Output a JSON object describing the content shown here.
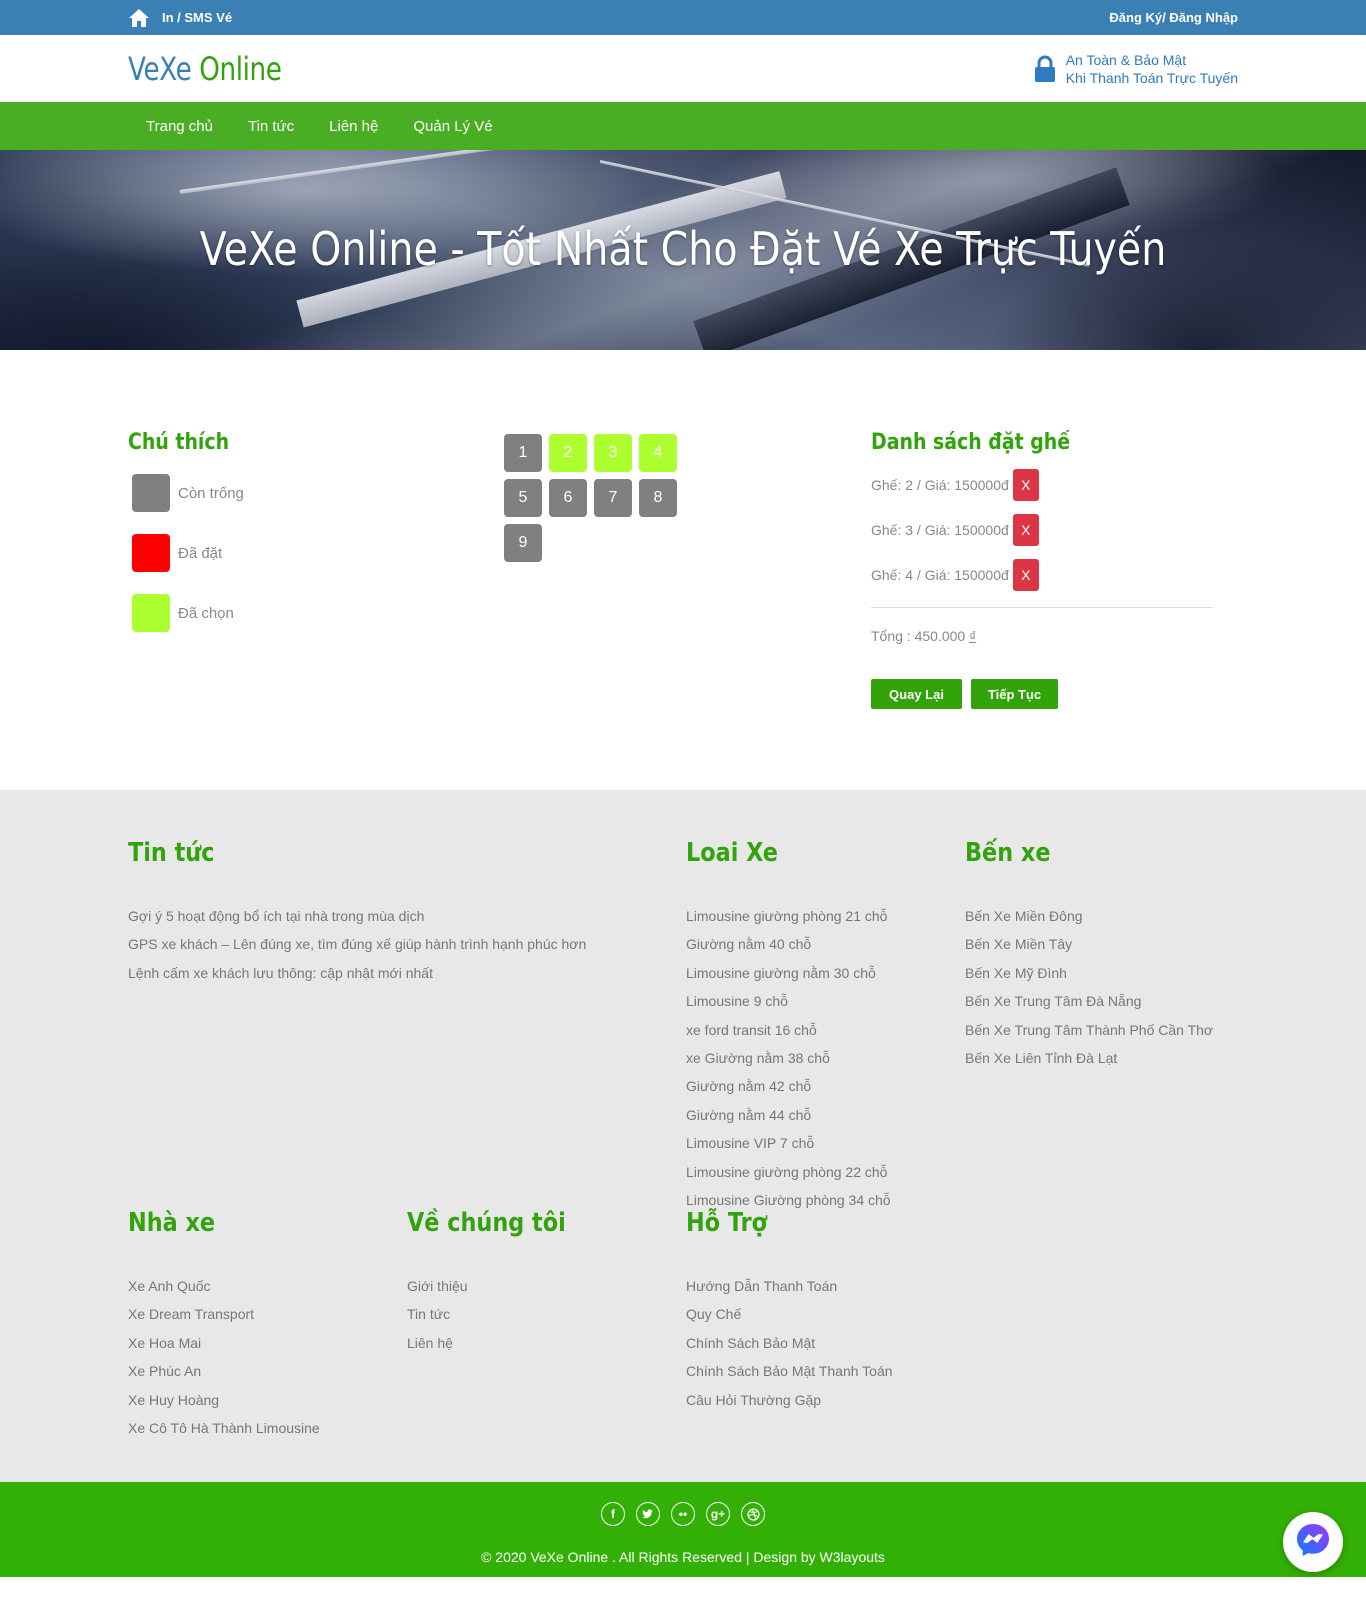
{
  "topbar": {
    "print_label": "In / SMS Vé",
    "auth_label": "Đăng Ký/ Đăng Nhập"
  },
  "brand": {
    "logo_part1": "VeXe",
    "logo_part2": "Online",
    "secure_line1": "An Toàn & Bảo Mật",
    "secure_line2": "Khi Thanh Toán Trực Tuyến"
  },
  "nav": [
    "Trang chủ",
    "Tin tức",
    "Liên hệ",
    "Quản Lý Vé"
  ],
  "hero": {
    "title": "VeXe Online - Tốt Nhất Cho Đặt Vé Xe Trực Tuyến"
  },
  "legend": {
    "title": "Chú thích",
    "items": [
      {
        "label": "Còn trống",
        "color": "#808080"
      },
      {
        "label": "Đã đặt",
        "color": "#ff0000"
      },
      {
        "label": "Đã chọn",
        "color": "#adff2f"
      }
    ]
  },
  "seats": [
    {
      "number": "1",
      "status": "free"
    },
    {
      "number": "2",
      "status": "selected"
    },
    {
      "number": "3",
      "status": "selected"
    },
    {
      "number": "4",
      "status": "selected"
    },
    {
      "number": "5",
      "status": "free"
    },
    {
      "number": "6",
      "status": "free"
    },
    {
      "number": "7",
      "status": "free"
    },
    {
      "number": "8",
      "status": "free"
    },
    {
      "number": "9",
      "status": "free"
    }
  ],
  "booking": {
    "title": "Danh sách đặt ghế",
    "items": [
      {
        "text": "Ghế: 2 / Giá: 150000đ",
        "remove": "X"
      },
      {
        "text": "Ghế: 3 / Giá: 150000đ",
        "remove": "X"
      },
      {
        "text": "Ghế: 4 / Giá: 150000đ",
        "remove": "X"
      }
    ],
    "total_label": "Tổng : 450.000",
    "currency": "₫",
    "back_label": "Quay Lại",
    "next_label": "Tiếp Tục"
  },
  "footer": {
    "news": {
      "title": "Tin tức",
      "items": [
        "Gợi ý 5 hoạt động bổ ích tại nhà trong mùa dịch",
        "GPS xe khách – Lên đúng xe, tìm đúng xế giúp hành trình hạnh phúc hơn",
        "Lệnh cấm xe khách lưu thông: cập nhật mới nhất"
      ]
    },
    "types": {
      "title": "Loai Xe",
      "items": [
        "Limousine giường phòng 21 chỗ",
        "Giường nằm 40 chỗ",
        "Limousine giường nằm 30 chỗ",
        "Limousine 9 chỗ",
        "xe ford transit 16 chỗ",
        "xe Giường nằm 38 chỗ",
        "Giường nằm 42 chỗ",
        "Giường nằm 44 chỗ",
        "Limousine VIP 7 chỗ",
        "Limousine giường phòng 22 chỗ",
        "Limousine Giường phòng 34 chỗ"
      ]
    },
    "stations": {
      "title": "Bến xe",
      "items": [
        "Bến Xe Miền Đông",
        "Bến Xe Miền Tây",
        "Bến Xe Mỹ Đình",
        "Bến Xe Trung Tâm Đà Nẵng",
        "Bến Xe Trung Tâm Thành Phố Cần Thơ",
        "Bến Xe Liên Tỉnh Đà Lạt"
      ]
    },
    "operators": {
      "title": "Nhà xe",
      "items": [
        "Xe Anh Quốc",
        "Xe Dream Transport",
        "Xe Hoa Mai",
        "Xe Phúc An",
        "Xe Huy Hoàng",
        "Xe Cô Tô Hà Thành Limousine"
      ]
    },
    "about": {
      "title": "Về chúng tôi",
      "items": [
        "Giới thiệu",
        "Tin tức",
        "Liên hệ"
      ]
    },
    "support": {
      "title": "Hỗ Trợ",
      "items": [
        "Hướng Dẫn Thanh Toán",
        "Quy Chế",
        "Chính Sách Bảo Mật",
        "Chính Sách Bảo Mật Thanh Toán",
        "Câu Hỏi Thường Gặp"
      ]
    }
  },
  "bottom": {
    "socials": [
      "facebook-icon",
      "twitter-icon",
      "flickr-icon",
      "google-plus-icon",
      "dribbble-icon"
    ],
    "copyright": "© 2020 VeXe Online . All Rights Reserved | Design by W3layouts"
  },
  "colors": {
    "topbar": "#3b80b4",
    "nav": "#49ae24",
    "accent_green": "#33a30c",
    "footer_bar": "#33b005",
    "danger": "#dc3545"
  }
}
